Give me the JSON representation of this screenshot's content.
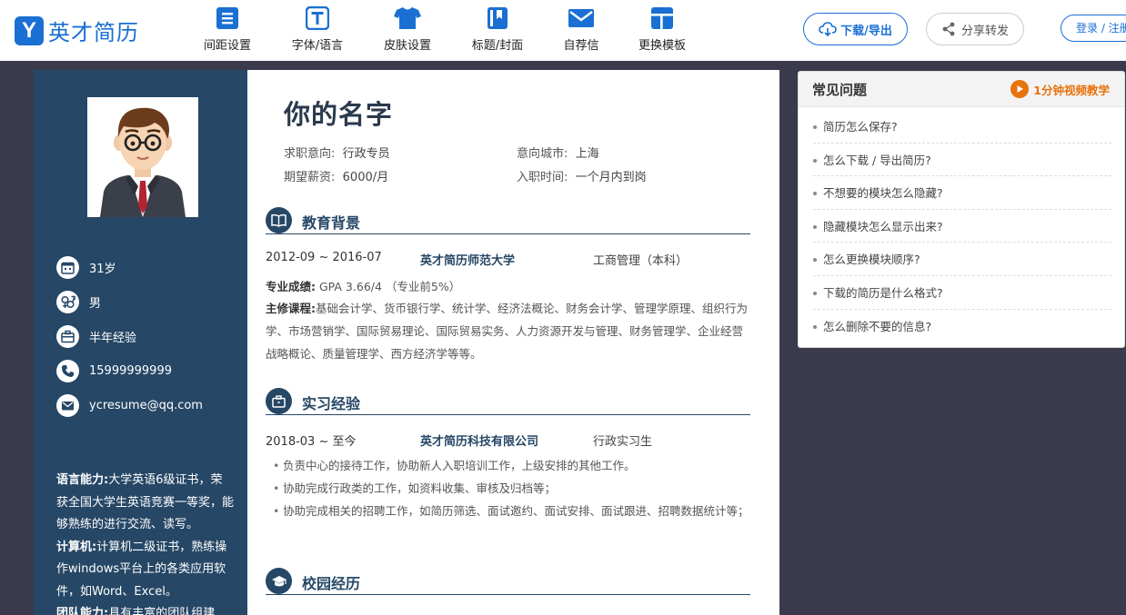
{
  "logo": {
    "badge": "Y",
    "text": "英才简历"
  },
  "nav": [
    {
      "label": "间距设置",
      "icon": "list-icon"
    },
    {
      "label": "字体/语言",
      "icon": "font-icon"
    },
    {
      "label": "皮肤设置",
      "icon": "tshirt-icon"
    },
    {
      "label": "标题/封面",
      "icon": "bookmark-book-icon"
    },
    {
      "label": "自荐信",
      "icon": "envelope-icon"
    },
    {
      "label": "更换模板",
      "icon": "template-icon"
    }
  ],
  "actions": {
    "download": "下载/导出",
    "share": "分享转发",
    "login": "登录 / 注册"
  },
  "colors": {
    "brand": "#1a6fd3",
    "sidebar": "#264766",
    "page_bg": "#3a3a4c",
    "accent": "#e8720c"
  },
  "sidebar": {
    "age": "31岁",
    "gender": "男",
    "experience": "半年经验",
    "phone": "15999999999",
    "email": "ycresume@qq.com",
    "skills": [
      {
        "label": "语言能力:",
        "text": "大学英语6级证书，荣获全国大学生英语竞赛一等奖，能够熟练的进行交流、读写。"
      },
      {
        "label": "计算机:",
        "text": "计算机二级证书，熟练操作windows平台上的各类应用软件，如Word、Excel。"
      },
      {
        "label": "团队能力:",
        "text": "具有丰富的团队组建"
      }
    ]
  },
  "resume": {
    "name": "你的名字",
    "info": {
      "job_label": "求职意向:",
      "job": "行政专员",
      "city_label": "意向城市:",
      "city": "上海",
      "salary_label": "期望薪资:",
      "salary": "6000/月",
      "start_label": "入职时间:",
      "start": "一个月内到岗"
    },
    "education": {
      "title": "教育背景",
      "period": "2012-09 ~ 2016-07",
      "school": "英才简历师范大学",
      "major": "工商管理（本科）",
      "grade_label": "专业成绩:",
      "grade": "GPA 3.66/4 （专业前5%）",
      "courses_label": "主修课程:",
      "courses": "基础会计学、货币银行学、统计学、经济法概论、财务会计学、管理学原理、组织行为学、市场营销学、国际贸易理论、国际贸易实务、人力资源开发与管理、财务管理学、企业经营战略概论、质量管理学、西方经济学等等。"
    },
    "internship": {
      "title": "实习经验",
      "period": "2018-03 ~ 至今",
      "company": "英才简历科技有限公司",
      "role": "行政实习生",
      "bullets": [
        "负责中心的接待工作，协助新人入职培训工作，上级安排的其他工作。",
        "协助完成行政类的工作，如资料收集、审核及归档等；",
        "协助完成相关的招聘工作，如简历筛选、面试邀约、面试安排、面试跟进、招聘数据统计等；"
      ]
    },
    "campus": {
      "title": "校园经历"
    }
  },
  "faq": {
    "title": "常见问题",
    "video": "1分钟视频教学",
    "items": [
      "简历怎么保存?",
      "怎么下载 / 导出简历?",
      "不想要的模块怎么隐藏?",
      "隐藏模块怎么显示出来?",
      "怎么更换模块顺序?",
      "下载的简历是什么格式?",
      "怎么删除不要的信息?"
    ]
  }
}
